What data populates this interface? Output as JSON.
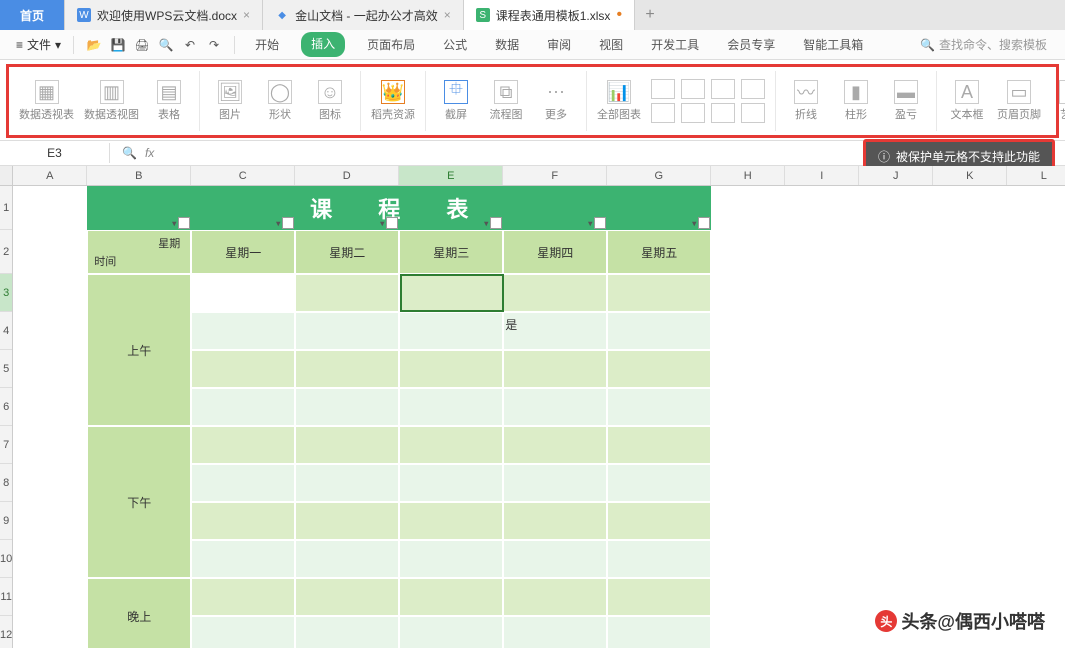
{
  "tabs": {
    "home": "首页",
    "items": [
      {
        "icon": "W",
        "label": "欢迎使用WPS云文档.docx",
        "dirty": false
      },
      {
        "icon": "cloud",
        "label": "金山文档 - 一起办公才高效",
        "dirty": false
      },
      {
        "icon": "S",
        "label": "课程表通用模板1.xlsx",
        "dirty": true,
        "active": true
      }
    ]
  },
  "menu": {
    "file": "文件",
    "main_tabs": [
      "开始",
      "插入",
      "页面布局",
      "公式",
      "数据",
      "审阅",
      "视图",
      "开发工具",
      "会员专享",
      "智能工具箱"
    ],
    "active_tab_index": 1,
    "search_placeholder": "查找命令、搜索模板"
  },
  "ribbon": {
    "groups": [
      [
        "数据透视表",
        "数据透视图",
        "表格"
      ],
      [
        "图片",
        "形状",
        "图标"
      ],
      [
        "稻壳资源"
      ],
      [
        "截屏",
        "流程图",
        "更多"
      ],
      [
        "全部图表"
      ],
      [
        "折线",
        "柱形",
        "盈亏"
      ],
      [
        "文本框",
        "页眉页脚",
        "艺术"
      ]
    ]
  },
  "formula_bar": {
    "name_box": "E3",
    "fx": "fx"
  },
  "tooltip": "被保护单元格不支持此功能",
  "columns": [
    "A",
    "B",
    "C",
    "D",
    "E",
    "F",
    "G",
    "H",
    "I",
    "J",
    "K",
    "L"
  ],
  "rows": [
    "1",
    "2",
    "3",
    "4",
    "5",
    "6",
    "7",
    "8",
    "9",
    "10",
    "11",
    "12"
  ],
  "selected": {
    "row": "3",
    "col": "E"
  },
  "timetable": {
    "title": "课 程 表",
    "corner_top": "星期",
    "corner_bottom": "时间",
    "days": [
      "星期一",
      "星期二",
      "星期三",
      "星期四",
      "星期五"
    ],
    "periods": [
      "上午",
      "下午",
      "晚上"
    ],
    "cell_value_shi": "是"
  },
  "watermark": "头条@偶西小嗒嗒"
}
